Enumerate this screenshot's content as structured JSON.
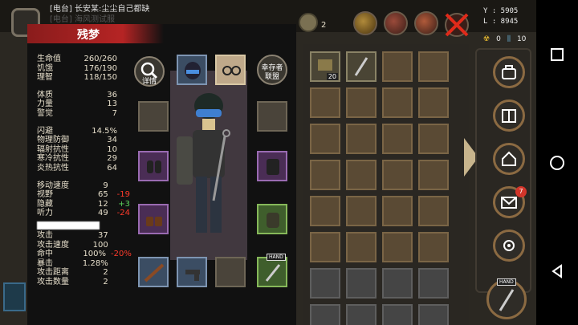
{
  "radio": {
    "line1": "[电台] 长安某:尘尘自己都缺",
    "line2": "[电台] 海风测试服"
  },
  "character": {
    "name": "残梦"
  },
  "stats": {
    "vitals": [
      {
        "label": "生命值",
        "value": "260/260"
      },
      {
        "label": "饥饿",
        "value": "176/190"
      },
      {
        "label": "理智",
        "value": "118/150"
      }
    ],
    "attributes": [
      {
        "label": "体质",
        "value": "36"
      },
      {
        "label": "力量",
        "value": "13"
      },
      {
        "label": "警觉",
        "value": "7"
      }
    ],
    "defense": [
      {
        "label": "闪避",
        "value": "14.5%"
      },
      {
        "label": "物理防御",
        "value": "34"
      },
      {
        "label": "辐射抗性",
        "value": "10"
      },
      {
        "label": "寒冷抗性",
        "value": "29"
      },
      {
        "label": "炎热抗性",
        "value": "64"
      }
    ],
    "movement": [
      {
        "label": "移动速度",
        "value": "9",
        "mod": ""
      },
      {
        "label": "视野",
        "value": "65",
        "mod": "-19"
      },
      {
        "label": "隐藏",
        "value": "12",
        "mod": "+3"
      },
      {
        "label": "听力",
        "value": "49",
        "mod": "-24"
      }
    ],
    "combat": [
      {
        "label": "攻击",
        "value": "37",
        "mod": ""
      },
      {
        "label": "攻击速度",
        "value": "100",
        "mod": ""
      },
      {
        "label": "命中",
        "value": "100%",
        "mod": "-20%"
      },
      {
        "label": "暴击",
        "value": "1.28%",
        "mod": ""
      },
      {
        "label": "攻击距离",
        "value": "2",
        "mod": ""
      },
      {
        "label": "攻击数量",
        "value": "2",
        "mod": ""
      }
    ]
  },
  "buttons": {
    "details": "详情",
    "survivor_alliance_1": "幸存者",
    "survivor_alliance_2": "联盟"
  },
  "equipment": {
    "hand_tag": "HAND"
  },
  "inventory": {
    "stack_count": "20",
    "rows": 8,
    "cols": 4
  },
  "hud": {
    "coord_y": ": 5905",
    "coord_x": ": 8945",
    "coord_y_label": "Y",
    "coord_x_label": "L",
    "currency_count": "2",
    "radiation": "0",
    "tool_count": "10",
    "mail_badge": "7"
  },
  "colors": {
    "accent_red": "#b52424",
    "debuff": "#ff3b2b",
    "buff": "#5bd35b"
  }
}
